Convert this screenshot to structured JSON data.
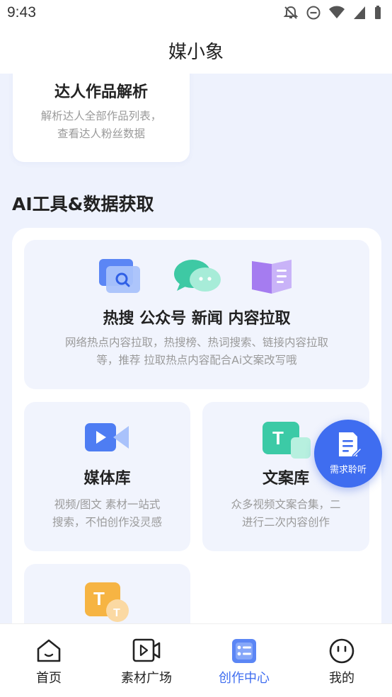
{
  "status_bar": {
    "time": "9:43"
  },
  "app": {
    "title": "媒小象"
  },
  "top_card": {
    "title": "达人作品解析",
    "desc_line1": "解析达人全部作品列表，",
    "desc_line2": "查看达人粉丝数据"
  },
  "section": {
    "title": "AI工具&数据获取"
  },
  "tools": {
    "crawl": {
      "title": "热搜 公众号 新闻 内容拉取",
      "desc_line1": "网络热点内容拉取，热搜榜、热词搜索、链接内容拉取",
      "desc_line2": "等，推荐 拉取热点内容配合Ai文案改写哦"
    },
    "media": {
      "title": "媒体库",
      "desc_line1": "视频/图文 素材一站式",
      "desc_line2": "搜索，不怕创作没灵感"
    },
    "copy": {
      "title": "文案库",
      "desc_line1": "众多视频文案合集，二",
      "desc_line2": "进行二次内容创作"
    }
  },
  "fab": {
    "label": "需求聆听"
  },
  "tabbar": {
    "items": [
      {
        "label": "首页",
        "icon": "home-icon"
      },
      {
        "label": "素材广场",
        "icon": "video-icon"
      },
      {
        "label": "创作中心",
        "icon": "list-icon",
        "active": true
      },
      {
        "label": "我的",
        "icon": "smile-icon"
      }
    ]
  },
  "colors": {
    "accent": "#3f6df0",
    "background": "#eef2fd",
    "tile": "#f1f4fd"
  }
}
